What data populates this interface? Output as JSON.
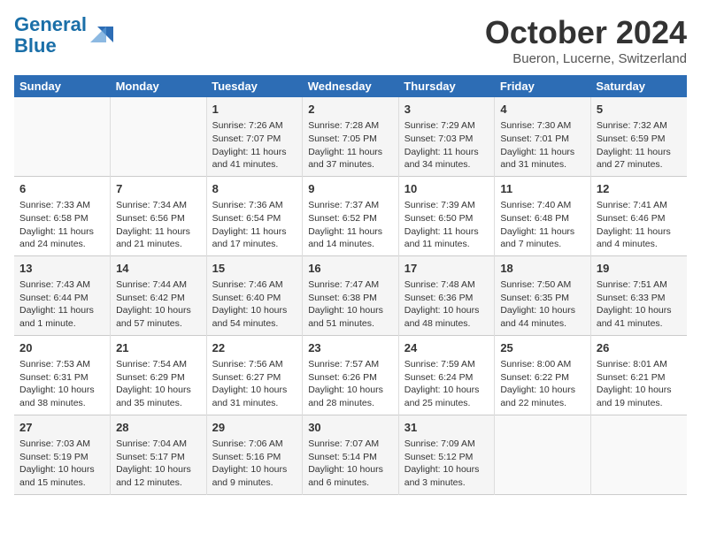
{
  "header": {
    "logo_line1": "General",
    "logo_line2": "Blue",
    "month": "October 2024",
    "location": "Bueron, Lucerne, Switzerland"
  },
  "days_of_week": [
    "Sunday",
    "Monday",
    "Tuesday",
    "Wednesday",
    "Thursday",
    "Friday",
    "Saturday"
  ],
  "weeks": [
    [
      {
        "day": "",
        "info": ""
      },
      {
        "day": "",
        "info": ""
      },
      {
        "day": "1",
        "info": "Sunrise: 7:26 AM\nSunset: 7:07 PM\nDaylight: 11 hours and 41 minutes."
      },
      {
        "day": "2",
        "info": "Sunrise: 7:28 AM\nSunset: 7:05 PM\nDaylight: 11 hours and 37 minutes."
      },
      {
        "day": "3",
        "info": "Sunrise: 7:29 AM\nSunset: 7:03 PM\nDaylight: 11 hours and 34 minutes."
      },
      {
        "day": "4",
        "info": "Sunrise: 7:30 AM\nSunset: 7:01 PM\nDaylight: 11 hours and 31 minutes."
      },
      {
        "day": "5",
        "info": "Sunrise: 7:32 AM\nSunset: 6:59 PM\nDaylight: 11 hours and 27 minutes."
      }
    ],
    [
      {
        "day": "6",
        "info": "Sunrise: 7:33 AM\nSunset: 6:58 PM\nDaylight: 11 hours and 24 minutes."
      },
      {
        "day": "7",
        "info": "Sunrise: 7:34 AM\nSunset: 6:56 PM\nDaylight: 11 hours and 21 minutes."
      },
      {
        "day": "8",
        "info": "Sunrise: 7:36 AM\nSunset: 6:54 PM\nDaylight: 11 hours and 17 minutes."
      },
      {
        "day": "9",
        "info": "Sunrise: 7:37 AM\nSunset: 6:52 PM\nDaylight: 11 hours and 14 minutes."
      },
      {
        "day": "10",
        "info": "Sunrise: 7:39 AM\nSunset: 6:50 PM\nDaylight: 11 hours and 11 minutes."
      },
      {
        "day": "11",
        "info": "Sunrise: 7:40 AM\nSunset: 6:48 PM\nDaylight: 11 hours and 7 minutes."
      },
      {
        "day": "12",
        "info": "Sunrise: 7:41 AM\nSunset: 6:46 PM\nDaylight: 11 hours and 4 minutes."
      }
    ],
    [
      {
        "day": "13",
        "info": "Sunrise: 7:43 AM\nSunset: 6:44 PM\nDaylight: 11 hours and 1 minute."
      },
      {
        "day": "14",
        "info": "Sunrise: 7:44 AM\nSunset: 6:42 PM\nDaylight: 10 hours and 57 minutes."
      },
      {
        "day": "15",
        "info": "Sunrise: 7:46 AM\nSunset: 6:40 PM\nDaylight: 10 hours and 54 minutes."
      },
      {
        "day": "16",
        "info": "Sunrise: 7:47 AM\nSunset: 6:38 PM\nDaylight: 10 hours and 51 minutes."
      },
      {
        "day": "17",
        "info": "Sunrise: 7:48 AM\nSunset: 6:36 PM\nDaylight: 10 hours and 48 minutes."
      },
      {
        "day": "18",
        "info": "Sunrise: 7:50 AM\nSunset: 6:35 PM\nDaylight: 10 hours and 44 minutes."
      },
      {
        "day": "19",
        "info": "Sunrise: 7:51 AM\nSunset: 6:33 PM\nDaylight: 10 hours and 41 minutes."
      }
    ],
    [
      {
        "day": "20",
        "info": "Sunrise: 7:53 AM\nSunset: 6:31 PM\nDaylight: 10 hours and 38 minutes."
      },
      {
        "day": "21",
        "info": "Sunrise: 7:54 AM\nSunset: 6:29 PM\nDaylight: 10 hours and 35 minutes."
      },
      {
        "day": "22",
        "info": "Sunrise: 7:56 AM\nSunset: 6:27 PM\nDaylight: 10 hours and 31 minutes."
      },
      {
        "day": "23",
        "info": "Sunrise: 7:57 AM\nSunset: 6:26 PM\nDaylight: 10 hours and 28 minutes."
      },
      {
        "day": "24",
        "info": "Sunrise: 7:59 AM\nSunset: 6:24 PM\nDaylight: 10 hours and 25 minutes."
      },
      {
        "day": "25",
        "info": "Sunrise: 8:00 AM\nSunset: 6:22 PM\nDaylight: 10 hours and 22 minutes."
      },
      {
        "day": "26",
        "info": "Sunrise: 8:01 AM\nSunset: 6:21 PM\nDaylight: 10 hours and 19 minutes."
      }
    ],
    [
      {
        "day": "27",
        "info": "Sunrise: 7:03 AM\nSunset: 5:19 PM\nDaylight: 10 hours and 15 minutes."
      },
      {
        "day": "28",
        "info": "Sunrise: 7:04 AM\nSunset: 5:17 PM\nDaylight: 10 hours and 12 minutes."
      },
      {
        "day": "29",
        "info": "Sunrise: 7:06 AM\nSunset: 5:16 PM\nDaylight: 10 hours and 9 minutes."
      },
      {
        "day": "30",
        "info": "Sunrise: 7:07 AM\nSunset: 5:14 PM\nDaylight: 10 hours and 6 minutes."
      },
      {
        "day": "31",
        "info": "Sunrise: 7:09 AM\nSunset: 5:12 PM\nDaylight: 10 hours and 3 minutes."
      },
      {
        "day": "",
        "info": ""
      },
      {
        "day": "",
        "info": ""
      }
    ]
  ]
}
